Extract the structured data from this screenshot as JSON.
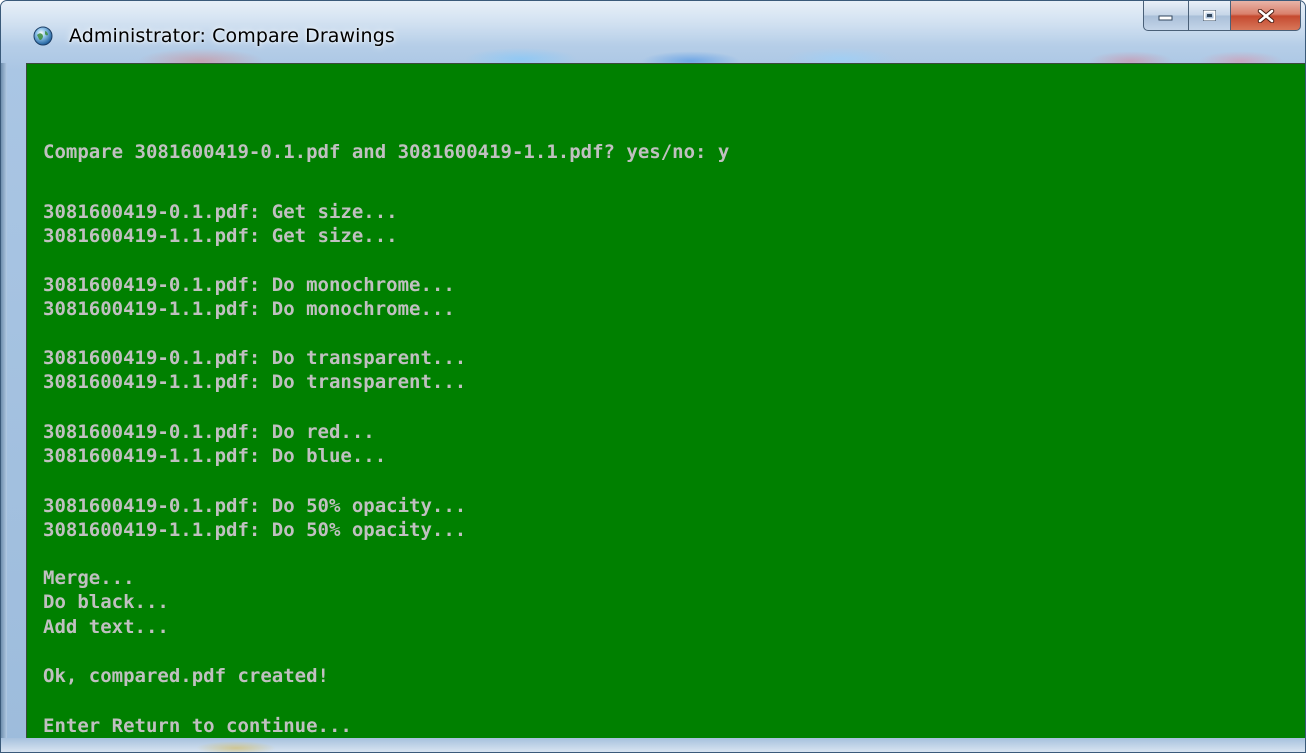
{
  "window": {
    "title": "Administrator:  Compare Drawings",
    "icon": "console-globe-icon",
    "buttons": {
      "minimize": "minimize-icon",
      "maximize": "maximize-icon",
      "close": "close-icon"
    }
  },
  "colors": {
    "console_background": "#008000",
    "console_text": "#c0c0c0"
  },
  "console": {
    "lines": [
      "",
      "",
      "Compare 3081600419-0.1.pdf and 3081600419-1.1.pdf? yes/no: y",
      "",
      "",
      "3081600419-0.1.pdf: Get size...",
      "3081600419-1.1.pdf: Get size...",
      "",
      "3081600419-0.1.pdf: Do monochrome...",
      "3081600419-1.1.pdf: Do monochrome...",
      "",
      "3081600419-0.1.pdf: Do transparent...",
      "3081600419-1.1.pdf: Do transparent...",
      "",
      "3081600419-0.1.pdf: Do red...",
      "3081600419-1.1.pdf: Do blue...",
      "",
      "3081600419-0.1.pdf: Do 50% opacity...",
      "3081600419-1.1.pdf: Do 50% opacity...",
      "",
      "Merge...",
      "Do black...",
      "Add text...",
      "",
      "Ok, compared.pdf created!",
      "",
      "Enter Return to continue..."
    ]
  }
}
